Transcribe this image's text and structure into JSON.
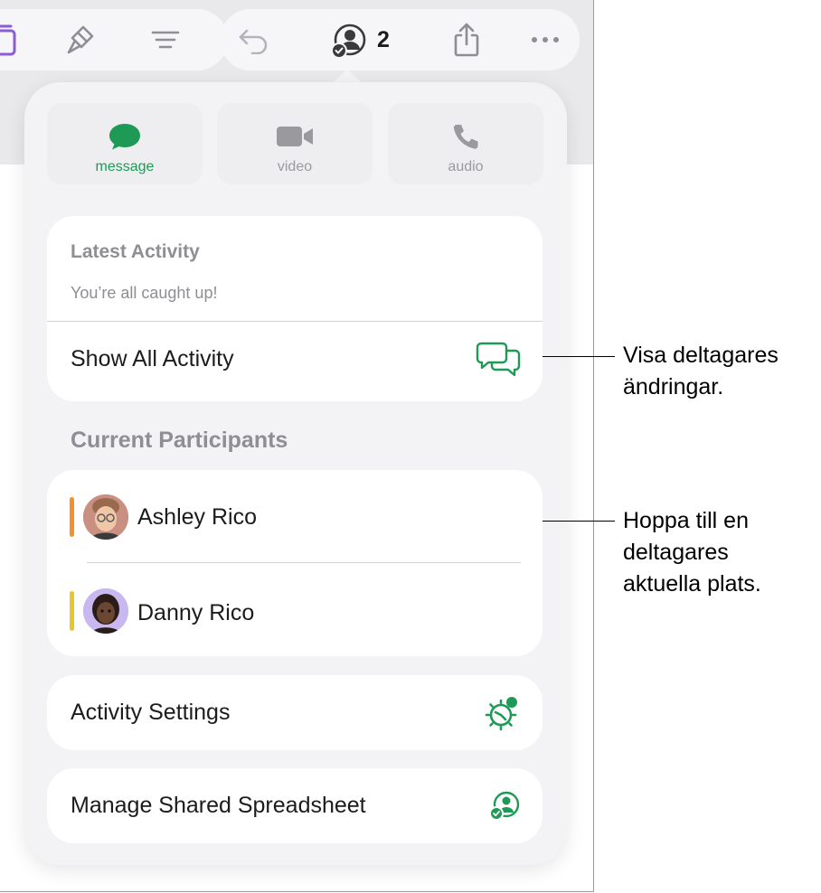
{
  "toolbar": {
    "participant_count": "2",
    "icons": [
      "sheets-icon",
      "format-brush-icon",
      "organize-icon",
      "undo-icon",
      "collaboration-icon",
      "share-icon",
      "more-icon"
    ]
  },
  "communication": [
    {
      "label": "message",
      "icon": "message-bubble-icon",
      "active": true
    },
    {
      "label": "video",
      "icon": "video-camera-icon",
      "active": false
    },
    {
      "label": "audio",
      "icon": "phone-icon",
      "active": false
    }
  ],
  "latest_activity": {
    "title": "Latest Activity",
    "status": "You’re all caught up!",
    "show_all_label": "Show All Activity"
  },
  "participants": {
    "title": "Current Participants",
    "items": [
      {
        "name": "Ashley Rico",
        "color": "#f5902a"
      },
      {
        "name": "Danny Rico",
        "color": "#e8c62c"
      }
    ]
  },
  "activity_settings_label": "Activity Settings",
  "manage_shared_label": "Manage Shared Spreadsheet",
  "callouts": [
    {
      "lines": [
        "Visa deltagares",
        "ändringar."
      ]
    },
    {
      "lines": [
        "Hoppa till en",
        "deltagares",
        "aktuella plats."
      ]
    }
  ],
  "colors": {
    "accent_green": "#1e9a56",
    "toolbar_bg": "#e9e9eb",
    "popover_bg": "#f3f3f5"
  }
}
